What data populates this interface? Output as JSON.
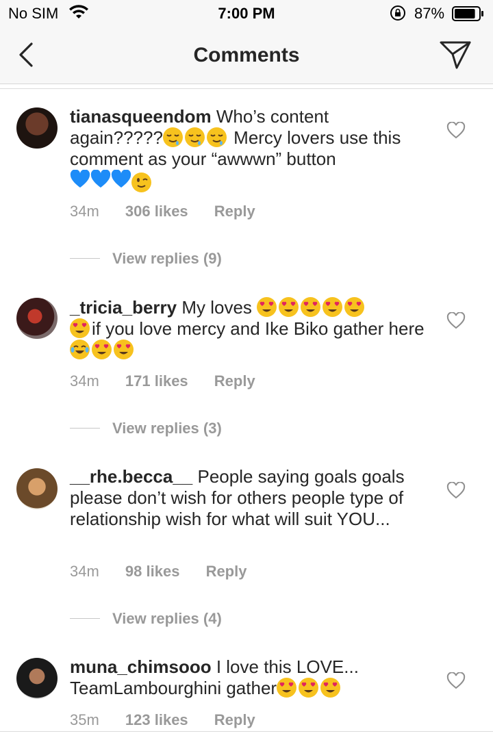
{
  "status_bar": {
    "carrier": "No SIM",
    "time": "7:00 PM",
    "battery_percent": "87%",
    "battery_level": 0.87,
    "icons": [
      "wifi-icon",
      "orientation-lock-icon",
      "battery-icon"
    ]
  },
  "nav": {
    "title": "Comments",
    "back_icon": "chevron-left-icon",
    "send_icon": "paper-plane-icon"
  },
  "comments": [
    {
      "username": "tianasqueendom",
      "text_part1": "Who’s content again?????",
      "text_part2": "Mercy lovers use this comment as your “awwwn” button",
      "emoji_groups": [
        "drooling-face x3",
        "blue-heart x3, winking-face"
      ],
      "time": "34m",
      "likes": "306 likes",
      "reply": "Reply",
      "view_replies": "View replies (9)"
    },
    {
      "username": "_tricia_berry",
      "text_part1": "My loves",
      "text_part2": "if you love mercy and Ike Biko gather here",
      "emoji_groups": [
        "heart-eyes x6",
        "joy, heart-eyes x2"
      ],
      "time": "34m",
      "likes": "171 likes",
      "reply": "Reply",
      "view_replies": "View replies (3)"
    },
    {
      "username": "__rhe.becca__",
      "text_part1": "People saying goals goals please don’t wish for others people type of relationship wish for what will suit YOU...",
      "time": "34m",
      "likes": "98 likes",
      "reply": "Reply",
      "view_replies": "View replies (4)"
    },
    {
      "username": "muna_chimsooo",
      "text_part1": "I love this LOVE... TeamLambourghini gather",
      "emoji_groups": [
        "heart-eyes x3"
      ],
      "time": "35m",
      "likes": "123 likes",
      "reply": "Reply"
    }
  ],
  "colors": {
    "text": "#262626",
    "meta": "#999999",
    "bar_bg": "#f7f7f7",
    "emoji_yellow": "#f7c21e",
    "heart_red": "#e0245e",
    "blue_heart": "#1d8cf8"
  }
}
